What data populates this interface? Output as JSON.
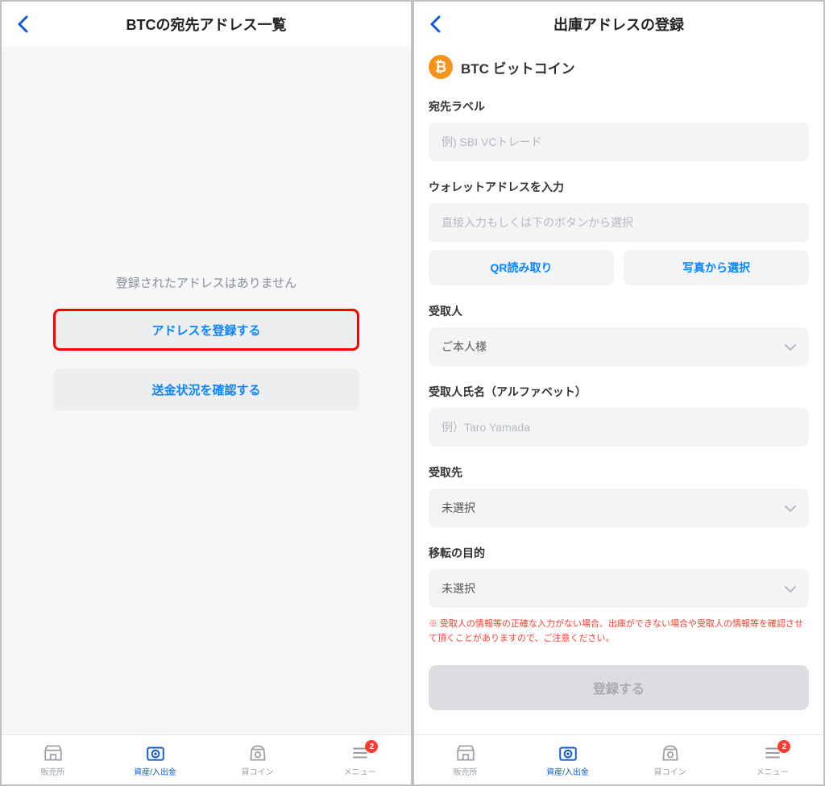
{
  "left": {
    "header_title": "BTCの宛先アドレス一覧",
    "empty_text": "登録されたアドレスはありません",
    "register_btn": "アドレスを登録する",
    "check_btn": "送金状況を確認する"
  },
  "right": {
    "header_title": "出庫アドレスの登録",
    "coin_name": "BTC ビットコイン",
    "label_field": "宛先ラベル",
    "label_placeholder": "例) SBI VCトレード",
    "wallet_field": "ウォレットアドレスを入力",
    "wallet_placeholder": "直接入力もしくは下のボタンから選択",
    "qr_btn": "QR読み取り",
    "photo_btn": "写真から選択",
    "recipient_field": "受取人",
    "recipient_value": "ご本人様",
    "recipient_name_field": "受取人氏名（アルファベット）",
    "recipient_name_placeholder": "例）Taro Yamada",
    "destination_field": "受取先",
    "destination_value": "未選択",
    "purpose_field": "移転の目的",
    "purpose_value": "未選択",
    "warning": "※ 受取人の情報等の正確な入力がない場合、出庫ができない場合や受取人の情報等を確認させて頂くことがありますので、ご注意ください。",
    "submit_btn": "登録する"
  },
  "tabs": {
    "t1": "販売所",
    "t2": "資産/入出金",
    "t3": "貸コイン",
    "t4": "メニュー",
    "badge": "2"
  }
}
